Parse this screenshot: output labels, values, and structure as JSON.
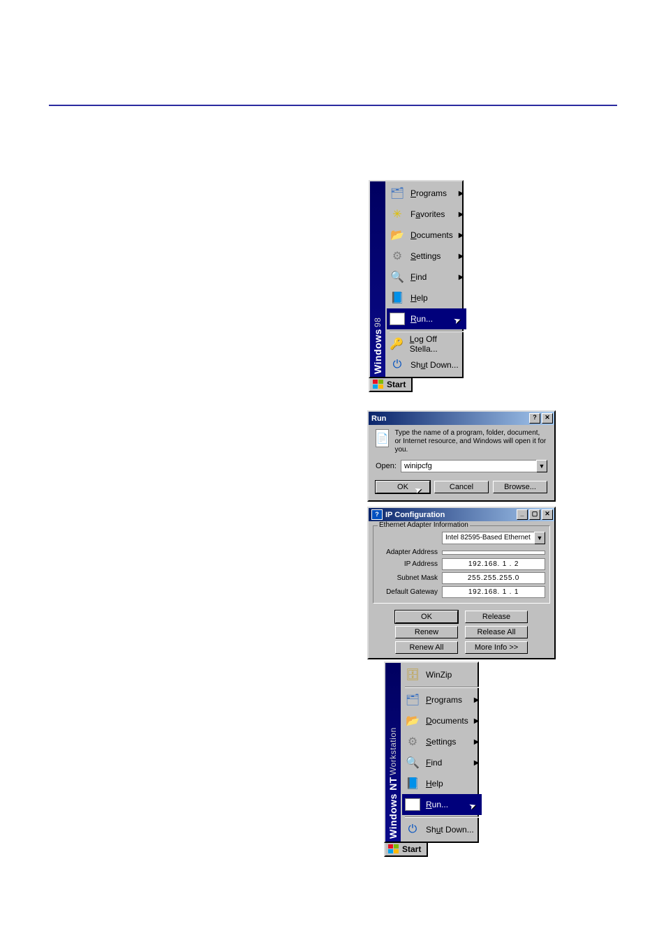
{
  "start98": {
    "band_main": "Windows",
    "band_sub": "98",
    "items": [
      {
        "icon": "programs-icon",
        "label": "Programs",
        "u": "P",
        "arrow": true
      },
      {
        "icon": "favorites-icon",
        "label": "Favorites",
        "u": "a",
        "arrow": true
      },
      {
        "icon": "documents-icon",
        "label": "Documents",
        "u": "D",
        "arrow": true
      },
      {
        "icon": "settings-icon",
        "label": "Settings",
        "u": "S",
        "arrow": true
      },
      {
        "icon": "find-icon",
        "label": "Find",
        "u": "F",
        "arrow": true
      },
      {
        "icon": "help-icon",
        "label": "Help",
        "u": "H",
        "arrow": false
      },
      {
        "icon": "run-icon",
        "label": "Run...",
        "u": "R",
        "arrow": false,
        "selected": true
      },
      {
        "sep": true
      },
      {
        "icon": "logoff-icon",
        "label": "Log Off Stella...",
        "u": "L",
        "arrow": false
      },
      {
        "icon": "shutdown-icon",
        "label": "Shut Down...",
        "u": "u",
        "arrow": false
      }
    ],
    "start_button": "Start"
  },
  "run": {
    "title": "Run",
    "description": "Type the name of a program, folder, document, or Internet resource, and Windows will open it for you.",
    "open_label": "Open:",
    "open_value": "winipcfg",
    "ok": "OK",
    "cancel": "Cancel",
    "browse": "Browse..."
  },
  "ipcfg": {
    "title": "IP Configuration",
    "group_label": "Ethernet Adapter Information",
    "adapter_selected": "Intel 82595-Based Ethernet",
    "rows": {
      "adapter_address_label": "Adapter Address",
      "adapter_address_value": "",
      "ip_label": "IP Address",
      "ip_value": "192.168.  1 . 2",
      "subnet_label": "Subnet Mask",
      "subnet_value": "255.255.255.0",
      "gateway_label": "Default Gateway",
      "gateway_value": "192.168.  1 . 1"
    },
    "buttons": {
      "ok": "OK",
      "release": "Release",
      "renew": "Renew",
      "release_all": "Release All",
      "renew_all": "Renew All",
      "more_info": "More Info >>"
    }
  },
  "startnt": {
    "band_main": "Windows NT",
    "band_sub": "Workstation",
    "items": [
      {
        "icon": "winzip-icon",
        "label": "WinZip",
        "u": "",
        "arrow": false
      },
      {
        "sep": true
      },
      {
        "icon": "programs-icon",
        "label": "Programs",
        "u": "P",
        "arrow": true
      },
      {
        "icon": "documents-icon",
        "label": "Documents",
        "u": "D",
        "arrow": true
      },
      {
        "icon": "settings-icon",
        "label": "Settings",
        "u": "S",
        "arrow": true
      },
      {
        "icon": "find-icon",
        "label": "Find",
        "u": "F",
        "arrow": true
      },
      {
        "icon": "help-icon",
        "label": "Help",
        "u": "H",
        "arrow": false
      },
      {
        "icon": "run-icon",
        "label": "Run...",
        "u": "R",
        "arrow": false,
        "selected": true
      },
      {
        "sep": true
      },
      {
        "icon": "shutdown-icon",
        "label": "Shut Down...",
        "u": "u",
        "arrow": false
      }
    ],
    "start_button": "Start"
  },
  "glyphs": {
    "programs-icon": "🗂",
    "favorites-icon": "✳",
    "documents-icon": "📂",
    "settings-icon": "⚙",
    "find-icon": "🔍",
    "help-icon": "📘",
    "run-icon": "▶",
    "logoff-icon": "🔑",
    "shutdown-icon": "⏻",
    "winzip-icon": "🗄",
    "arrow": "▶",
    "dropdown": "▼",
    "help_btn": "?",
    "close_btn": "✕",
    "min_btn": "_",
    "max_btn": "▢"
  }
}
